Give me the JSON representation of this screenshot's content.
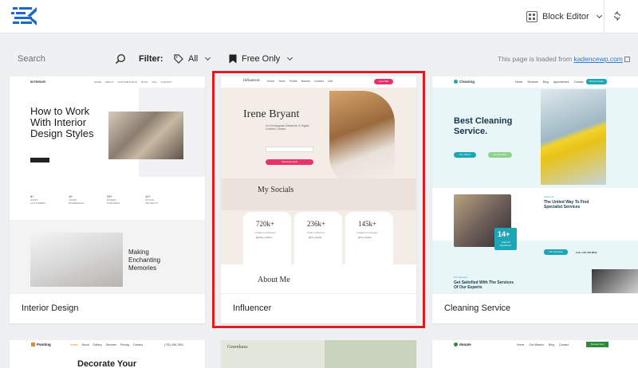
{
  "header": {
    "logo_name": "kadence-logo",
    "editor_label": "Block Editor"
  },
  "filters": {
    "search_placeholder": "Search",
    "filter_label": "Filter:",
    "category_value": "All",
    "price_value": "Free Only",
    "loaded_prefix": "This page is loaded from",
    "loaded_link": "kadencewp.com"
  },
  "cards": [
    {
      "caption": "Interior Design",
      "nav": [
        "HOME",
        "ABOUT",
        "OUR PORTFOLIO",
        "BLOG",
        "FAQ",
        "CONTACT"
      ],
      "brand": "INTERIOR",
      "headline": "How to Work With Interior Design Styles",
      "stats": [
        {
          "num": "8+",
          "label": "HAPPY CUSTOMERS"
        },
        {
          "num": "10",
          "label": "YEARS EXPERIENCE"
        },
        {
          "num": "25+",
          "label": "EXPERT PARTNERS"
        },
        {
          "num": "12+",
          "label": "ACTIVE PROJECTS"
        }
      ],
      "sub_headline": "Making Enchanting Memories"
    },
    {
      "caption": "Influencer",
      "brand": "Influencer.",
      "nav": [
        "Home",
        "Store",
        "Profile",
        "Brands",
        "Contact",
        "Cart"
      ],
      "cta": "Let's Talk",
      "name": "Irene Bryant",
      "tagline": "I'm A Instagram Influencer & Digital Content Creator.",
      "subscribe": "Subscribe Now",
      "socials_title": "My Socials",
      "socials": [
        {
          "count": "720k+",
          "label": "Instagram Followers",
          "handle": "@irene_bryant"
        },
        {
          "count": "236k+",
          "label": "Twitter Followers",
          "handle": "@irn_bryant"
        },
        {
          "count": "145k+",
          "label": "Instagram Followers",
          "handle": "@irn_bryant"
        }
      ],
      "about_title": "About Me"
    },
    {
      "caption": "Cleaning Service",
      "brand": "Cleaning",
      "nav": [
        "Home",
        "Services",
        "Blog",
        "Appointment",
        "Contact"
      ],
      "cta": "Book A Clean",
      "headline": "Best Cleaning Service.",
      "offers_btn": "Our Offers",
      "services_btn": "Our Services",
      "section_kicker": "About Us",
      "section_title": "The United Way To Find Specialist Services",
      "badge_num": "14+",
      "badge_label": "Years Of Experience",
      "services_btn2": "Our Services",
      "phone": "Call +123 456 8823",
      "footer_title": "Get Satisfied With The Services Of Our Experts"
    },
    {
      "brand": "Painting",
      "nav": [
        "Home",
        "About",
        "Gallery",
        "Services",
        "Pricing",
        "Contact"
      ],
      "phone": "(732) 456-7891",
      "headline": "Decorate Your"
    },
    {
      "brand": "Greenhaus"
    },
    {
      "brand": "donate",
      "nav": [
        "Home",
        "Our Mission",
        "Blog",
        "Contact"
      ],
      "cta": "Donate Now"
    }
  ],
  "colors": {
    "accent": "#2e7bd1",
    "selected": "#e01b22",
    "brand_blue": "#1e66d0"
  }
}
